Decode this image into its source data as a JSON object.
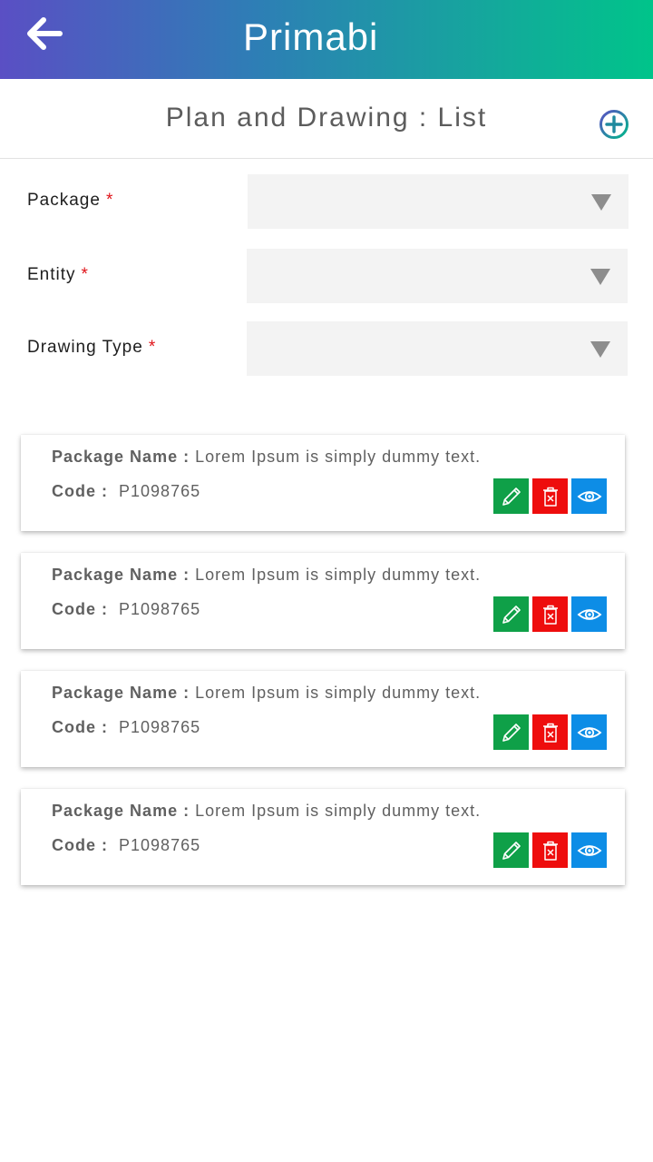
{
  "header": {
    "logo_text": "Primabi",
    "colors": {
      "gradient_start": "#5a4fc4",
      "gradient_end": "#00c48a"
    }
  },
  "page": {
    "title": "Plan and Drawing : List",
    "add_icon": "plus-circle-icon"
  },
  "filters": [
    {
      "label": "Package",
      "required_mark": "*",
      "value": ""
    },
    {
      "label": "Entity",
      "required_mark": "*",
      "value": ""
    },
    {
      "label": "Drawing Type",
      "required_mark": "*",
      "value": ""
    }
  ],
  "card_labels": {
    "package_name": "Package Name :",
    "code": "Code :"
  },
  "items": [
    {
      "package_name": "Lorem Ipsum is simply dummy text.",
      "code": "P1098765"
    },
    {
      "package_name": "Lorem Ipsum is simply dummy text.",
      "code": "P1098765"
    },
    {
      "package_name": "Lorem Ipsum is simply dummy text.",
      "code": "P1098765"
    },
    {
      "package_name": "Lorem Ipsum is simply dummy text.",
      "code": "P1098765"
    }
  ],
  "action_colors": {
    "edit": "#0fa048",
    "delete": "#ee0d0d",
    "view": "#0d8de6"
  }
}
